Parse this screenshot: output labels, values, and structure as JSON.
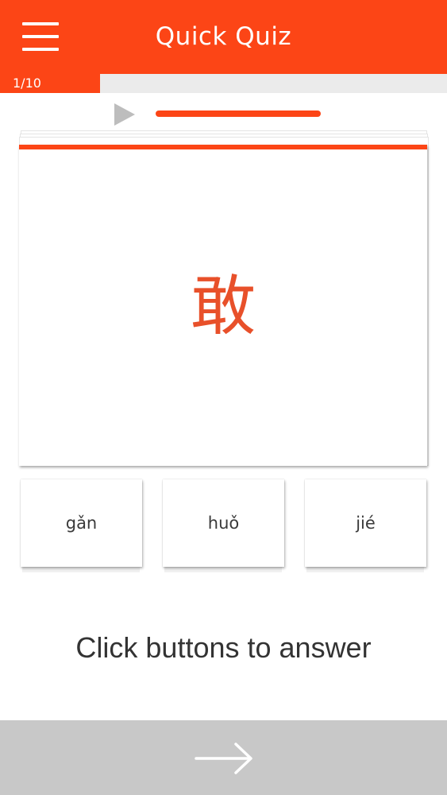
{
  "header": {
    "title": "Quick Quiz",
    "menu_icon": "hamburger-menu-icon",
    "color": "#fc4516"
  },
  "progress": {
    "label": "1/10",
    "current": 1,
    "total": 10
  },
  "audio": {
    "play_icon": "play-icon"
  },
  "flashcard": {
    "character": "敢",
    "character_color": "#e8502a"
  },
  "answers": [
    {
      "label": "gǎn"
    },
    {
      "label": "huǒ"
    },
    {
      "label": "jié"
    }
  ],
  "instruction": "Click buttons to answer",
  "footer": {
    "next_icon": "arrow-right-icon",
    "background": "#c8c8c8"
  }
}
